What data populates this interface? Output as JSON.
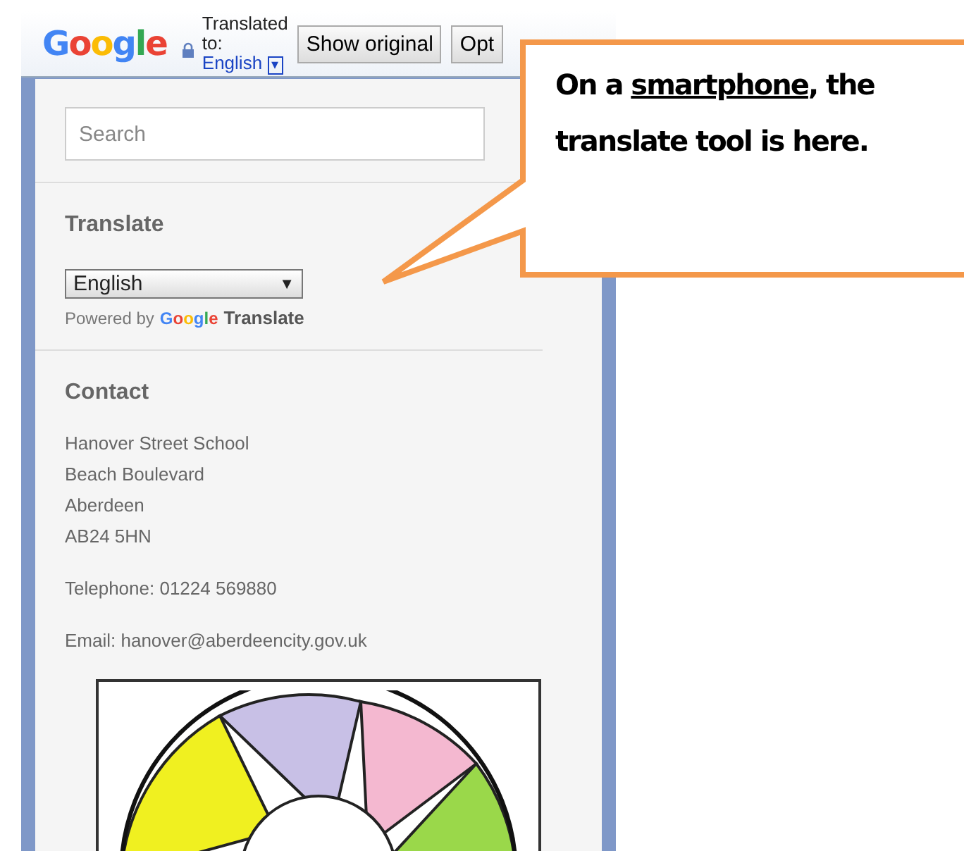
{
  "translate_bar": {
    "logo": "Google",
    "status_lines": [
      "Translated",
      "to:"
    ],
    "language": "English",
    "dropdown_glyph": "▾",
    "buttons": [
      "Show original",
      "Opt"
    ]
  },
  "search": {
    "placeholder": "Search"
  },
  "translate_widget": {
    "heading": "Translate",
    "select_value": "English",
    "select_glyph": "▼",
    "powered_by": "Powered by",
    "brand": "Google",
    "product": "Translate"
  },
  "contact": {
    "heading": "Contact",
    "address": [
      "Hanover Street School",
      "Beach Boulevard",
      "Aberdeen",
      "AB24 5HN"
    ],
    "telephone": "Telephone: 01224 569880",
    "email": "Email: hanover@aberdeencity.gov.uk"
  },
  "callout": {
    "segments": [
      {
        "text": "On a ",
        "underlined": false
      },
      {
        "text": "smartphone",
        "underlined": true
      },
      {
        "text": ", the translate tool is here.",
        "underlined": false
      }
    ]
  }
}
